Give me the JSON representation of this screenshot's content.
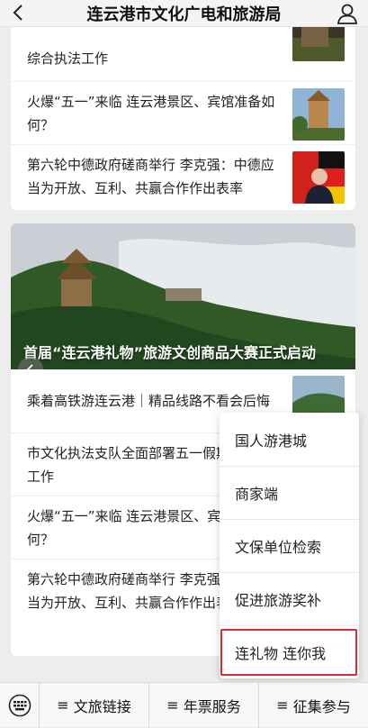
{
  "header": {
    "title": "连云港市文化广电和旅游局"
  },
  "top_card": [
    {
      "title": "综合执法工作"
    },
    {
      "title": "火爆“五一”来临 连云港景区、宾馆准备如何？"
    },
    {
      "title": "第六轮中德政府磋商举行 李克强：中德应当为开放、互利、共赢合作作出表率"
    }
  ],
  "hero": {
    "caption": "首届“连云港礼物”旅游文创商品大赛正式启动"
  },
  "list": [
    {
      "title": "乘着高铁游连云港｜精品线路不看会后悔"
    },
    {
      "title": "市文化执法支队全面部署五一假期综合执法工作"
    },
    {
      "title": "火爆“五一”来临 连云港景区、宾馆准备如何？"
    },
    {
      "title": "第六轮中德政府磋商举行 李克强：中德应当为开放、互利、共赢合作作出表率"
    }
  ],
  "popup": {
    "items": [
      "国人游港城",
      "商家端",
      "文保单位检索",
      "促进旅游奖补",
      "连礼物 连你我"
    ]
  },
  "bottom_menu": {
    "items": [
      "文旅链接",
      "年票服务",
      "征集参与"
    ],
    "menu_glyph": "≡"
  },
  "icons": {
    "back": "chevron-left-icon",
    "user": "user-icon",
    "keyboard": "keyboard-icon"
  },
  "colors": {
    "highlight": "#d82c2c"
  }
}
